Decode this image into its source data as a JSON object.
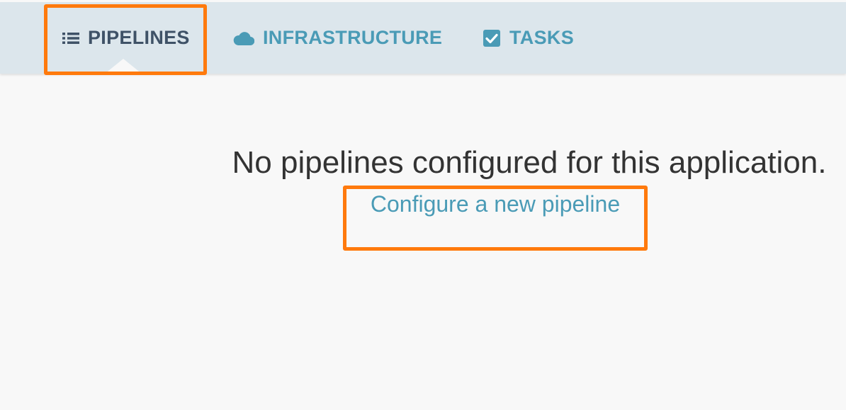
{
  "nav": {
    "tabs": [
      {
        "label": "PIPELINES",
        "icon": "list-icon",
        "active": true
      },
      {
        "label": "INFRASTRUCTURE",
        "icon": "cloud-icon",
        "active": false
      },
      {
        "label": "TASKS",
        "icon": "checkbox-icon",
        "active": false
      }
    ]
  },
  "main": {
    "empty_message": "No pipelines configured for this application.",
    "configure_link": "Configure a new pipeline"
  },
  "colors": {
    "nav_background": "#dce6ec",
    "active_tab_text": "#3f5267",
    "link": "#4a9bb6",
    "highlight": "#ff7a0d",
    "page_background": "#f8f8f8"
  }
}
